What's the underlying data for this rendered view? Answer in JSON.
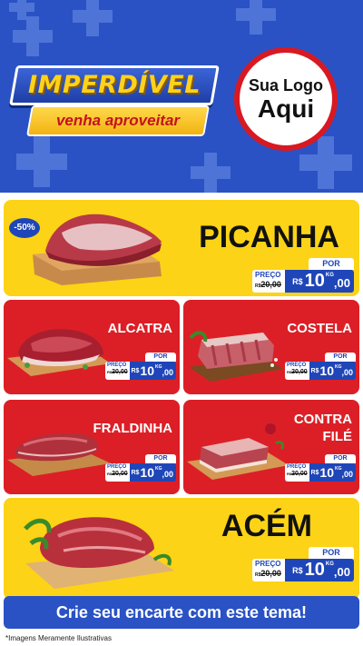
{
  "header": {
    "headline": "IMPERDÍVEL",
    "subline": "venha aproveitar",
    "logo_line1": "Sua Logo",
    "logo_line2": "Aqui"
  },
  "products": [
    {
      "name": "PICANHA",
      "discount": "-50%",
      "por": "POR",
      "preco": "PREÇO",
      "old_prefix": "R$",
      "old_price": "20,00",
      "currency": "R$",
      "price_int": "10",
      "price_dec": ",00",
      "unit": "KG"
    },
    {
      "name": "ALCATRA",
      "por": "POR",
      "preco": "PREÇO",
      "old_prefix": "R$",
      "old_price": "20,00",
      "currency": "R$",
      "price_int": "10",
      "price_dec": ",00",
      "unit": "KG"
    },
    {
      "name": "COSTELA",
      "por": "POR",
      "preco": "PREÇO",
      "old_prefix": "R$",
      "old_price": "20,00",
      "currency": "R$",
      "price_int": "10",
      "price_dec": ",00",
      "unit": "KG"
    },
    {
      "name": "FRALDINHA",
      "por": "POR",
      "preco": "PREÇO",
      "old_prefix": "R$",
      "old_price": "20,00",
      "currency": "R$",
      "price_int": "10",
      "price_dec": ",00",
      "unit": "KG"
    },
    {
      "name_line1": "CONTRA",
      "name_line2": "FILÉ",
      "por": "POR",
      "preco": "PREÇO",
      "old_prefix": "R$",
      "old_price": "20,00",
      "currency": "R$",
      "price_int": "10",
      "price_dec": ",00",
      "unit": "KG"
    },
    {
      "name": "ACÉM",
      "por": "POR",
      "preco": "PREÇO",
      "old_prefix": "R$",
      "old_price": "20,00",
      "currency": "R$",
      "price_int": "10",
      "price_dec": ",00",
      "unit": "KG"
    }
  ],
  "footer": {
    "cta": "Crie seu encarte com este tema!",
    "disclaimer": "*Imagens Meramente Ilustrativas"
  },
  "colors": {
    "blue": "#2a52c4",
    "yellow": "#fcd316",
    "red": "#dc1f26",
    "tag_blue": "#1f46b8"
  }
}
